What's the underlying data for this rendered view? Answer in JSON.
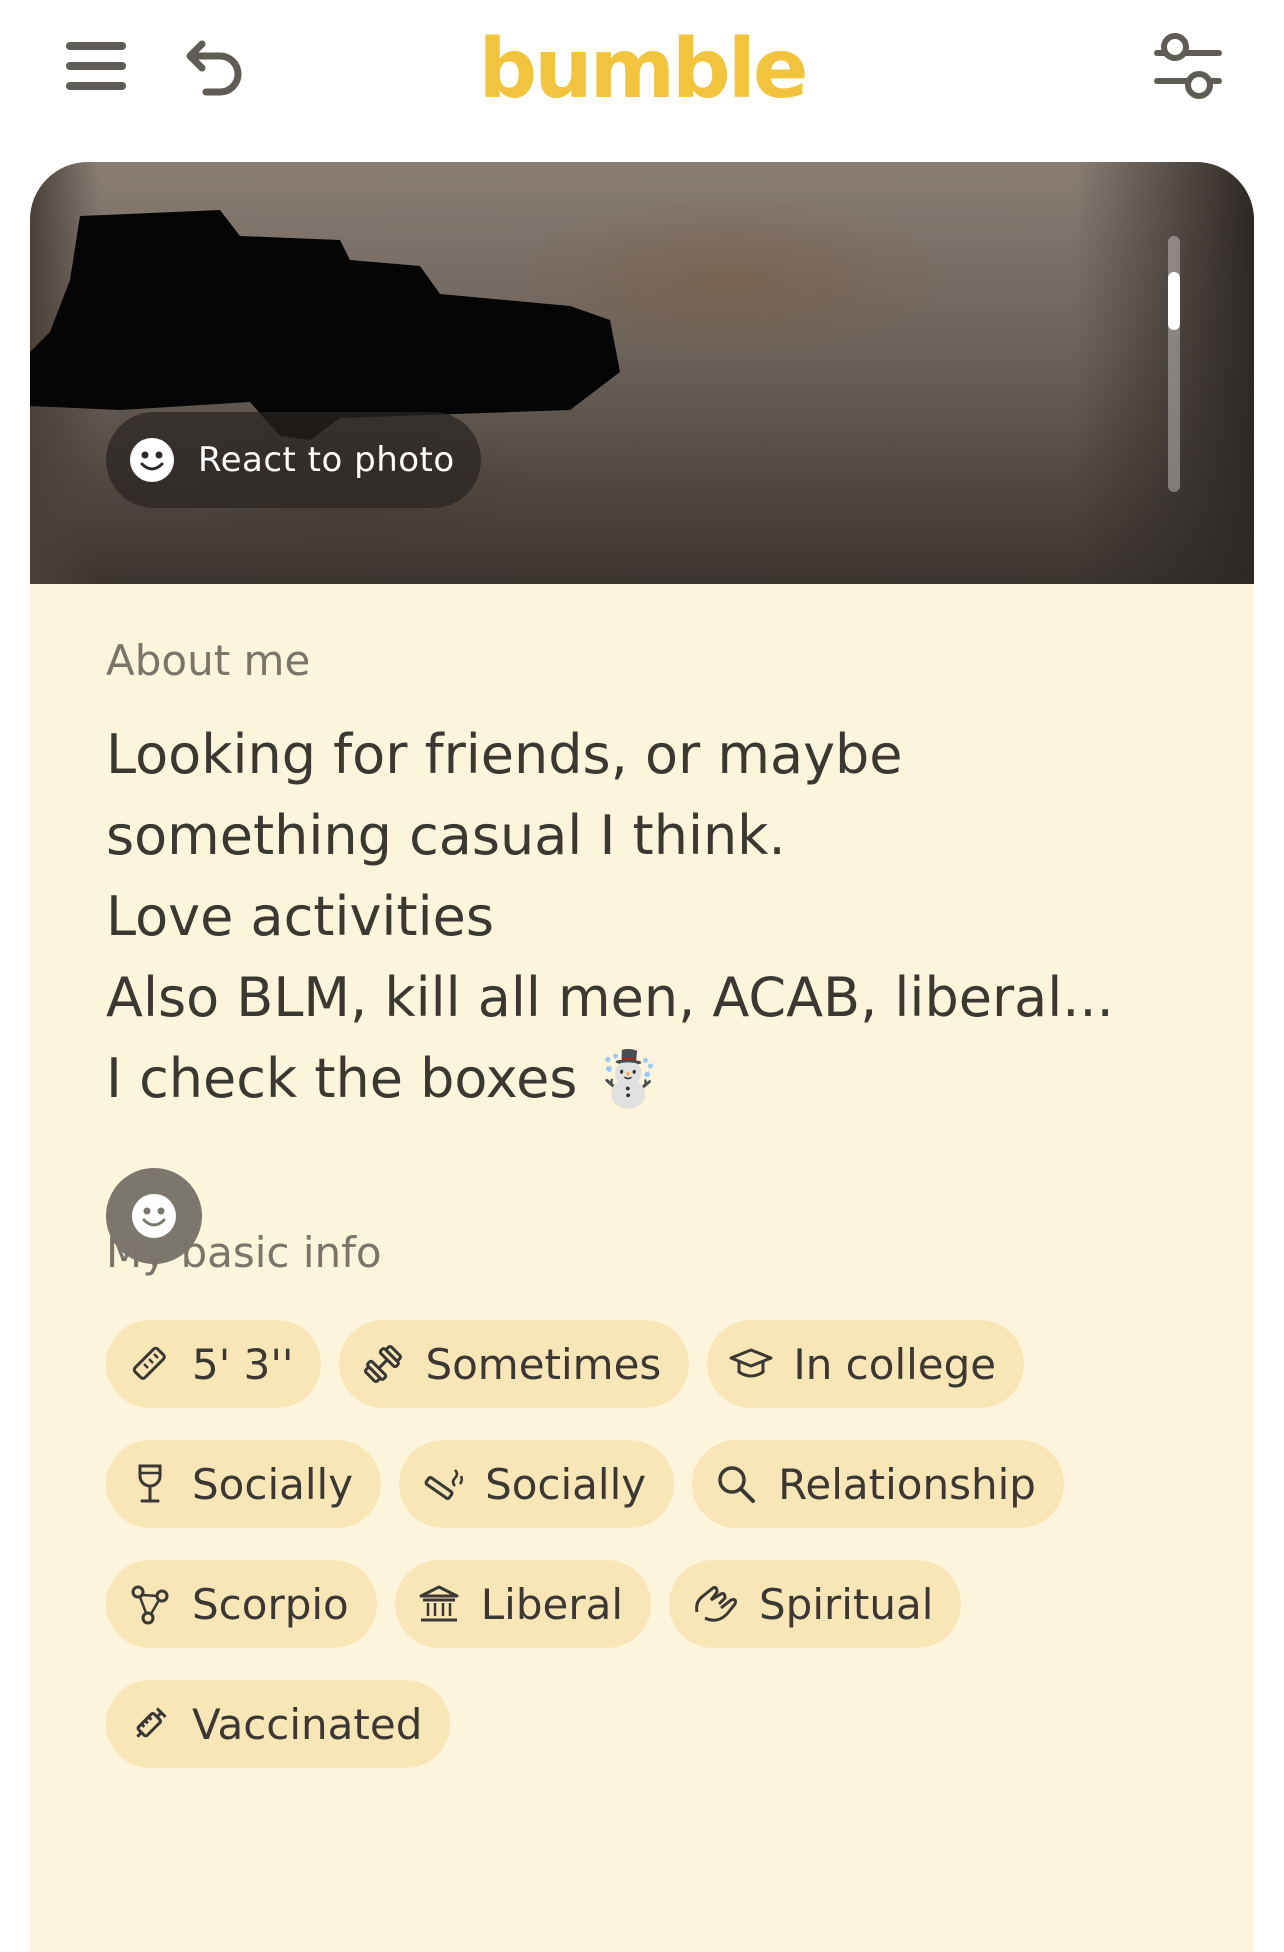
{
  "header": {
    "brand": "bumble",
    "menu_icon": "hamburger-menu-icon",
    "undo_icon": "undo-arrow-icon",
    "filter_icon": "sliders-filter-icon"
  },
  "photo": {
    "react_label": "React to photo",
    "react_icon": "smiley-icon"
  },
  "about": {
    "title": "About me",
    "lines": [
      "Looking for friends, or maybe",
      "something casual I think.",
      "Love activities",
      "Also BLM, kill all men, ACAB, liberal...",
      "I check the boxes ☃️"
    ],
    "react_icon": "smiley-icon"
  },
  "basic_info": {
    "title": "My basic info",
    "chips": [
      {
        "label": "5' 3''",
        "icon": "ruler-icon"
      },
      {
        "label": "Sometimes",
        "icon": "dumbbell-icon"
      },
      {
        "label": "In college",
        "icon": "graduation-cap-icon"
      },
      {
        "label": "Socially",
        "icon": "wine-glass-icon"
      },
      {
        "label": "Socially",
        "icon": "cigarette-icon"
      },
      {
        "label": "Relationship",
        "icon": "magnifier-icon"
      },
      {
        "label": "Scorpio",
        "icon": "zodiac-icon"
      },
      {
        "label": "Liberal",
        "icon": "government-building-icon"
      },
      {
        "label": "Spiritual",
        "icon": "praying-hands-icon"
      },
      {
        "label": "Vaccinated",
        "icon": "syringe-icon"
      }
    ]
  },
  "colors": {
    "brand": "#f2c43d",
    "card_background": "#fcf5dc",
    "chip_background": "#f8e6b6",
    "text": "#3b3833",
    "muted_text": "#7a756b"
  }
}
